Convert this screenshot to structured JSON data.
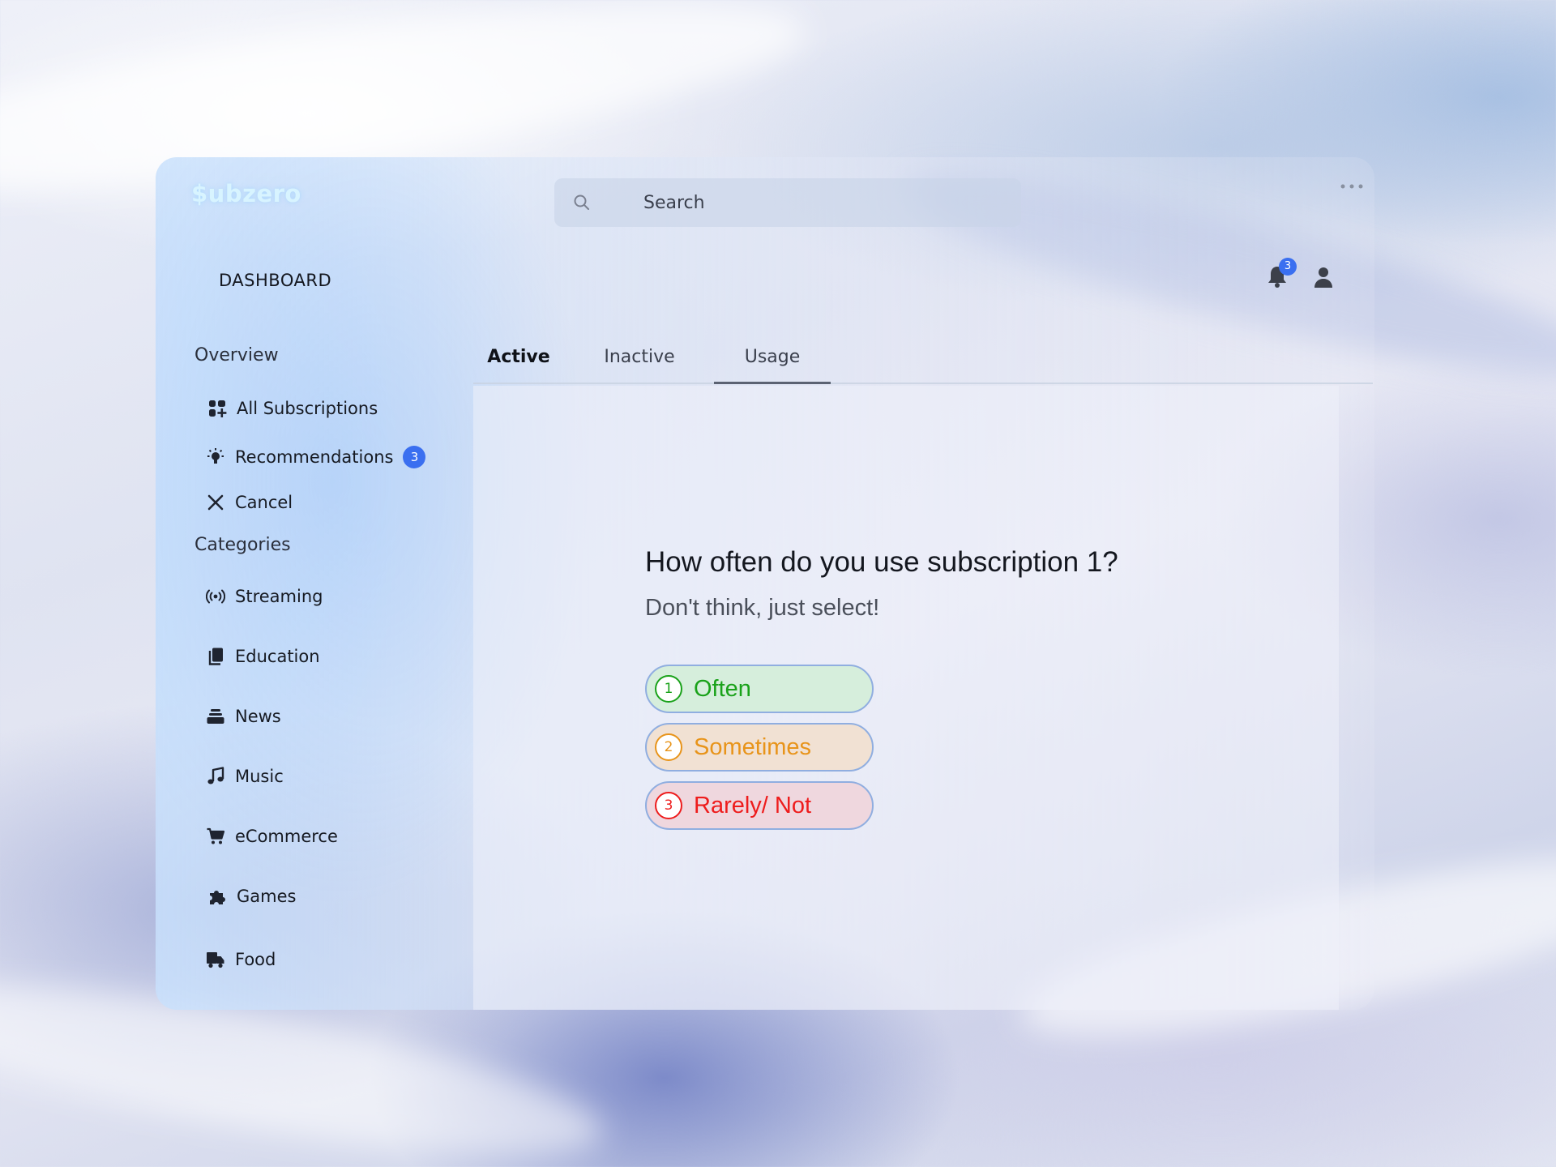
{
  "app": {
    "logo_text": "$ubzero",
    "page_title": "DASHBOARD",
    "notification_count": "3"
  },
  "search": {
    "placeholder": "Search",
    "value": ""
  },
  "sidebar": {
    "overview_heading": "Overview",
    "overview_items": [
      {
        "label": "All Subscriptions",
        "icon": "grid-plus-icon"
      },
      {
        "label": "Recommendations",
        "icon": "lightbulb-icon",
        "badge": "3"
      },
      {
        "label": "Cancel",
        "icon": "close-icon"
      }
    ],
    "categories_heading": "Categories",
    "category_items": [
      {
        "label": "Streaming",
        "icon": "broadcast-icon"
      },
      {
        "label": "Education",
        "icon": "documents-icon"
      },
      {
        "label": "News",
        "icon": "stack-icon"
      },
      {
        "label": "Music",
        "icon": "music-note-icon"
      },
      {
        "label": "eCommerce",
        "icon": "cart-icon"
      },
      {
        "label": "Games",
        "icon": "puzzle-icon"
      },
      {
        "label": "Food",
        "icon": "truck-icon"
      }
    ]
  },
  "tabs": [
    {
      "label": "Active",
      "state": "bold"
    },
    {
      "label": "Inactive",
      "state": "normal"
    },
    {
      "label": "Usage",
      "state": "selected"
    }
  ],
  "survey": {
    "question": "How often do you use subscription 1?",
    "subtext": "Don't think, just select!",
    "options": [
      {
        "number": "1",
        "label": "Often",
        "color": "#1aa21a",
        "background": "#d6eedc"
      },
      {
        "number": "2",
        "label": "Sometimes",
        "color": "#e8941a",
        "background": "#f1e1d3"
      },
      {
        "number": "3",
        "label": "Rarely/ Not",
        "color": "#ee1c1c",
        "background": "#efd7de"
      }
    ]
  },
  "colors": {
    "accent": "#3a6ff0",
    "logo": "#d8f4ff"
  }
}
